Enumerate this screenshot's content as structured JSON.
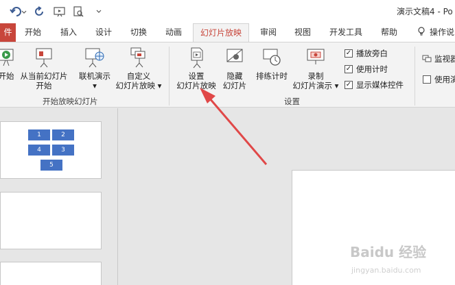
{
  "titlebar": {
    "title": "演示文稿4 - Po"
  },
  "tabs": {
    "file": "件",
    "items": [
      "开始",
      "插入",
      "设计",
      "切换",
      "动画",
      "幻灯片放映",
      "审阅",
      "视图",
      "开发工具",
      "帮助"
    ],
    "active": "幻灯片放映",
    "tell_me": "操作说"
  },
  "ribbon": {
    "start_group": {
      "from_beginning": "开始",
      "from_current_l1": "从当前幻灯片",
      "from_current_l2": "开始",
      "online_l1": "联机演示",
      "online_l2": "▾",
      "custom_l1": "自定义",
      "custom_l2": "幻灯片放映 ▾",
      "label": "开始放映幻灯片"
    },
    "setup_group": {
      "setup_l1": "设置",
      "setup_l2": "幻灯片放映",
      "hide_l1": "隐藏",
      "hide_l2": "幻灯片",
      "rehearse": "排练计时",
      "record_l1": "录制",
      "record_l2": "幻灯片演示 ▾",
      "chk_narration": "播放旁白",
      "chk_timings": "使用计时",
      "chk_media": "显示媒体控件",
      "label": "设置"
    },
    "monitor_group": {
      "monitor": "监视器",
      "presenter": "使用演"
    }
  },
  "thumbs": {
    "boxes": [
      "1",
      "2",
      "4",
      "3",
      "5"
    ]
  },
  "watermark": {
    "brand": "Baidu 经验",
    "url": "jingyan.baidu.com"
  }
}
